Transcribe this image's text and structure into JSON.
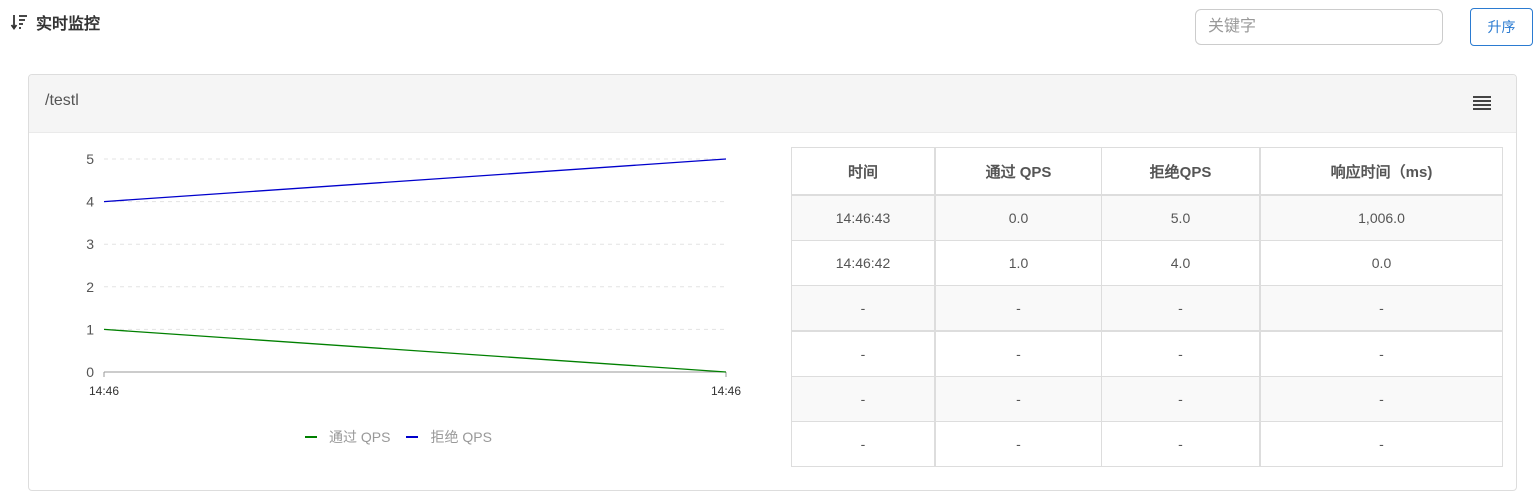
{
  "header": {
    "title": "实时监控",
    "search_placeholder": "关键字",
    "sort_button": "升序"
  },
  "panel": {
    "title": "/testl"
  },
  "legend": {
    "pass": "通过 QPS",
    "reject": "拒绝 QPS"
  },
  "colors": {
    "pass": "#008000",
    "reject": "#0000cc",
    "accent": "#2b7bd1"
  },
  "chart_data": {
    "type": "line",
    "x": [
      "14:46",
      "14:46"
    ],
    "yticks": [
      "0",
      "1",
      "2",
      "3",
      "4",
      "5"
    ],
    "ylim": [
      0,
      5
    ],
    "grid": true,
    "legend_position": "bottom",
    "series": [
      {
        "name": "通过 QPS",
        "values": [
          1,
          0
        ]
      },
      {
        "name": "拒绝 QPS",
        "values": [
          4,
          5
        ]
      }
    ]
  },
  "table": {
    "headers": [
      "时间",
      "通过 QPS",
      "拒绝QPS",
      "响应时间（ms)"
    ],
    "rows": [
      [
        "14:46:43",
        "0.0",
        "5.0",
        "1,006.0"
      ],
      [
        "14:46:42",
        "1.0",
        "4.0",
        "0.0"
      ],
      [
        "-",
        "-",
        "-",
        "-"
      ],
      [
        "-",
        "-",
        "-",
        "-"
      ],
      [
        "-",
        "-",
        "-",
        "-"
      ],
      [
        "-",
        "-",
        "-",
        "-"
      ]
    ]
  }
}
